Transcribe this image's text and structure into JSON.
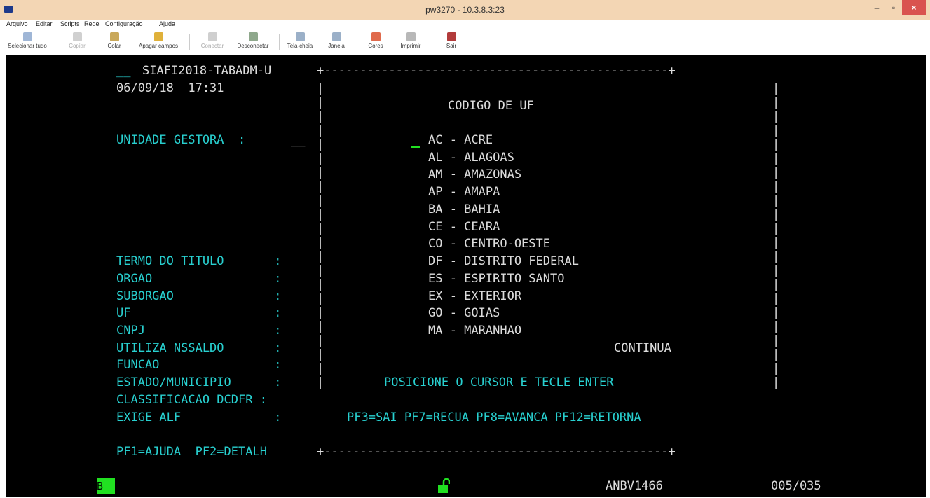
{
  "window": {
    "title": "pw3270 - 10.3.8.3:23"
  },
  "menu": [
    "Arquivo",
    "Editar",
    "Scripts",
    "Rede",
    "Configuração",
    "Ajuda"
  ],
  "toolbar": [
    {
      "label": "Selecionar tudo",
      "icon": "select-all-icon",
      "enabled": true
    },
    {
      "label": "Copiar",
      "icon": "copy-icon",
      "enabled": false
    },
    {
      "label": "Colar",
      "icon": "paste-icon",
      "enabled": true
    },
    {
      "label": "Apagar campos",
      "icon": "erase-fields-icon",
      "enabled": true
    },
    {
      "label": "Conectar",
      "icon": "connect-icon",
      "enabled": false
    },
    {
      "label": "Desconectar",
      "icon": "disconnect-icon",
      "enabled": true
    },
    {
      "label": "Tela-cheia",
      "icon": "fullscreen-icon",
      "enabled": true
    },
    {
      "label": "Janela",
      "icon": "window-icon",
      "enabled": true
    },
    {
      "label": "Cores",
      "icon": "colors-icon",
      "enabled": true
    },
    {
      "label": "Imprimir",
      "icon": "print-icon",
      "enabled": true
    },
    {
      "label": "Sair",
      "icon": "exit-icon",
      "enabled": true
    }
  ],
  "terminal": {
    "header_system": "SIAFI2018-TABADM-U",
    "date_time": "06/09/18  17:31",
    "box_top": "+------------------------------------------------+",
    "box_bottom": "+------------------------------------------------+",
    "popup_title": "CODIGO DE UF",
    "uf_list": [
      "AC - ACRE",
      "AL - ALAGOAS",
      "AM - AMAZONAS",
      "AP - AMAPA",
      "BA - BAHIA",
      "CE - CEARA",
      "CO - CENTRO-OESTE",
      "DF - DISTRITO FEDERAL",
      "ES - ESPIRITO SANTO",
      "EX - EXTERIOR",
      "GO - GOIAS",
      "MA - MARANHAO"
    ],
    "continua": "CONTINUA",
    "instruction": "POSICIONE O CURSOR E TECLE ENTER",
    "pf_keys": "PF3=SAI PF7=RECUA PF8=AVANCA PF12=RETORNA",
    "unidade_gestora_label": "UNIDADE GESTORA  :",
    "field_labels": [
      "TERMO DO TITULO       :",
      "ORGAO                 :",
      "SUBORGAO              :",
      "UF                    :",
      "CNPJ                  :",
      "UTILIZA NSSALDO       :",
      "FUNCAO                :",
      "ESTADO/MUNICIPIO      :",
      "CLASSIFICACAO DCDFR :",
      "EXIGE ALF             :"
    ],
    "bottom_keys": "PF1=AJUDA  PF2=DETALH",
    "status": {
      "indicator": "B",
      "session": "ANBV1466",
      "cursor_pos": "005/035"
    }
  }
}
